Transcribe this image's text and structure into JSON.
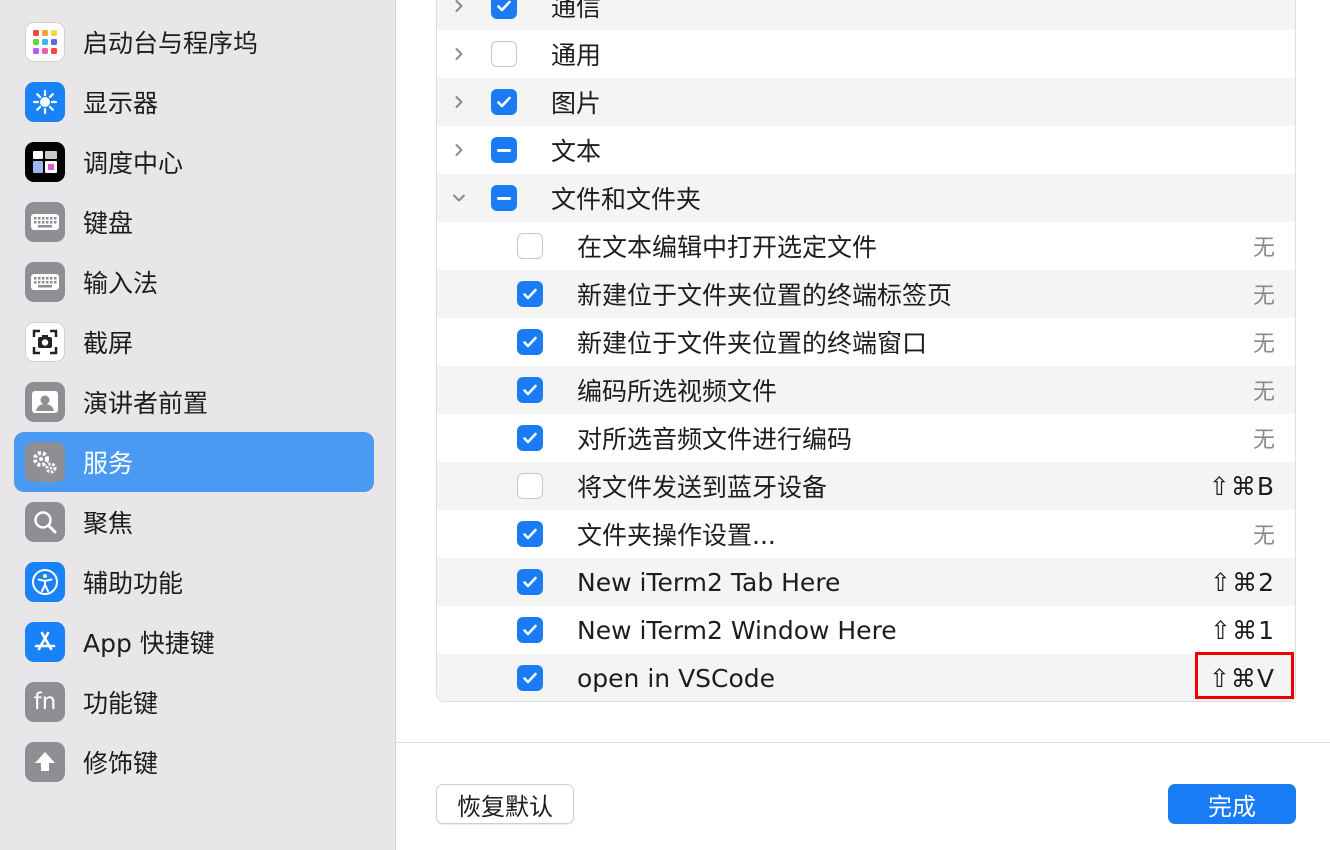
{
  "sidebar": {
    "items": [
      {
        "label": "启动台与程序坞",
        "icon": "launchpad-icon",
        "color": "#ffffff"
      },
      {
        "label": "显示器",
        "icon": "display-sun-icon",
        "color": "#1a82f7"
      },
      {
        "label": "调度中心",
        "icon": "mission-control-icon",
        "color": "#000000"
      },
      {
        "label": "键盘",
        "icon": "keyboard-icon",
        "color": "#8e8e93"
      },
      {
        "label": "输入法",
        "icon": "keyboard-icon",
        "color": "#8e8e93"
      },
      {
        "label": "截屏",
        "icon": "screenshot-icon",
        "color": "#ffffff"
      },
      {
        "label": "演讲者前置",
        "icon": "presenter-icon",
        "color": "#8e8e93"
      },
      {
        "label": "服务",
        "icon": "gears-icon",
        "color": "#8e8e93"
      },
      {
        "label": "聚焦",
        "icon": "magnifier-icon",
        "color": "#8e8e93"
      },
      {
        "label": "辅助功能",
        "icon": "accessibility-icon",
        "color": "#1a82f7"
      },
      {
        "label": "App 快捷键",
        "icon": "app-store-icon",
        "color": "#1a82f7"
      },
      {
        "label": "功能键",
        "icon": "fn-key-icon",
        "color": "#8e8e93"
      },
      {
        "label": "修饰键",
        "icon": "arrow-up-icon",
        "color": "#8e8e93"
      }
    ],
    "selected_index": 7,
    "selected_color": "#4a9af4"
  },
  "services": {
    "rows": [
      {
        "label": "通信",
        "level": 0,
        "expanded": false,
        "state": "on",
        "shortcut": ""
      },
      {
        "label": "通用",
        "level": 0,
        "expanded": false,
        "state": "off",
        "shortcut": ""
      },
      {
        "label": "图片",
        "level": 0,
        "expanded": false,
        "state": "on",
        "shortcut": ""
      },
      {
        "label": "文本",
        "level": 0,
        "expanded": false,
        "state": "mixed",
        "shortcut": ""
      },
      {
        "label": "文件和文件夹",
        "level": 0,
        "expanded": true,
        "state": "mixed",
        "shortcut": ""
      },
      {
        "label": "在文本编辑中打开选定文件",
        "level": 1,
        "state": "off",
        "shortcut": "无"
      },
      {
        "label": "新建位于文件夹位置的终端标签页",
        "level": 1,
        "state": "on",
        "shortcut": "无"
      },
      {
        "label": "新建位于文件夹位置的终端窗口",
        "level": 1,
        "state": "on",
        "shortcut": "无"
      },
      {
        "label": "编码所选视频文件",
        "level": 1,
        "state": "on",
        "shortcut": "无"
      },
      {
        "label": "对所选音频文件进行编码",
        "level": 1,
        "state": "on",
        "shortcut": "无"
      },
      {
        "label": "将文件发送到蓝牙设备",
        "level": 1,
        "state": "off",
        "shortcut": "⇧⌘B"
      },
      {
        "label": "文件夹操作设置...",
        "level": 1,
        "state": "on",
        "shortcut": "无"
      },
      {
        "label": "New iTerm2 Tab Here",
        "level": 1,
        "state": "on",
        "shortcut": "⇧⌘2"
      },
      {
        "label": "New iTerm2 Window Here",
        "level": 1,
        "state": "on",
        "shortcut": "⇧⌘1"
      },
      {
        "label": "open in VSCode",
        "level": 1,
        "state": "on",
        "shortcut": "⇧⌘V"
      }
    ],
    "none_label": "无"
  },
  "footer": {
    "restore_label": "恢复默认",
    "done_label": "完成"
  },
  "colors": {
    "accent": "#1a7cf5",
    "highlight_box": "#ee0000"
  }
}
